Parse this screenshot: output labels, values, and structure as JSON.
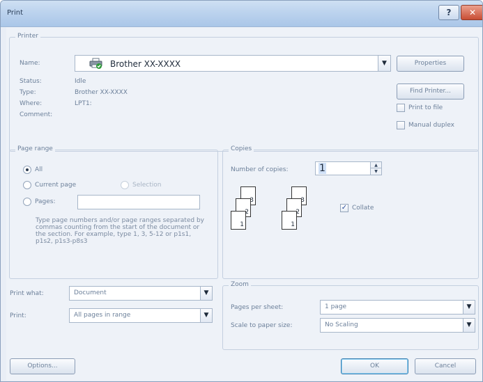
{
  "window": {
    "title": "Print"
  },
  "titlebar": {
    "help_label": "?",
    "close_label": "✕"
  },
  "printer": {
    "legend": "Printer",
    "name_label": "Name:",
    "name_value": "Brother XX-XXXX",
    "printer_icon": "printer-icon",
    "status_label": "Status:",
    "status_value": "Idle",
    "type_label": "Type:",
    "type_value": "Brother XX-XXXX",
    "where_label": "Where:",
    "where_value": "LPT1:",
    "comment_label": "Comment:",
    "properties_label": "Properties",
    "find_printer_label": "Find Printer...",
    "print_to_file_label": "Print to file",
    "manual_duplex_label": "Manual duplex"
  },
  "page_range": {
    "legend": "Page range",
    "all_label": "All",
    "current_page_label": "Current page",
    "selection_label": "Selection",
    "pages_label": "Pages:",
    "pages_value": "",
    "help_text": "Type page numbers and/or page ranges separated by commas counting from the start of the document or the section. For example, type 1, 3, 5-12 or p1s1, p1s2, p1s3-p8s3"
  },
  "copies": {
    "legend": "Copies",
    "number_label": "Number of copies:",
    "number_value": "1",
    "collate_label": "Collate",
    "collate_checked": true,
    "stack_labels": [
      "1",
      "2",
      "3"
    ]
  },
  "print_what": {
    "label": "Print what:",
    "value": "Document"
  },
  "print": {
    "label": "Print:",
    "value": "All pages in range"
  },
  "zoom": {
    "legend": "Zoom",
    "pages_per_sheet_label": "Pages per sheet:",
    "pages_per_sheet_value": "1 page",
    "scale_label": "Scale to paper size:",
    "scale_value": "No Scaling"
  },
  "footer": {
    "options_label": "Options...",
    "ok_label": "OK",
    "cancel_label": "Cancel"
  }
}
